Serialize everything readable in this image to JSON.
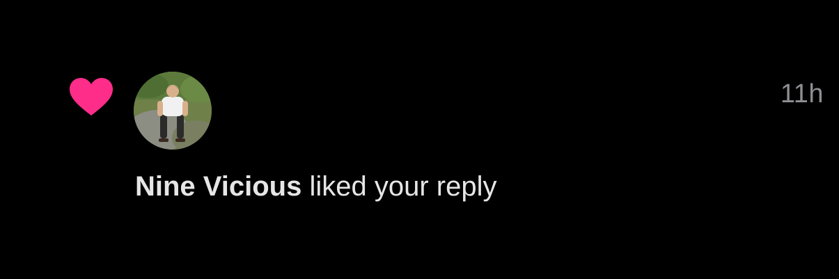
{
  "notification": {
    "type_icon": "heart-icon",
    "type_icon_color": "#ff2d8a",
    "avatar": "user-avatar-photo",
    "username": "Nine Vicious",
    "action_text": " liked your reply",
    "timestamp": "11h"
  },
  "colors": {
    "background": "#000000",
    "text": "#e6e6e6",
    "timestamp": "#8e8e93"
  }
}
